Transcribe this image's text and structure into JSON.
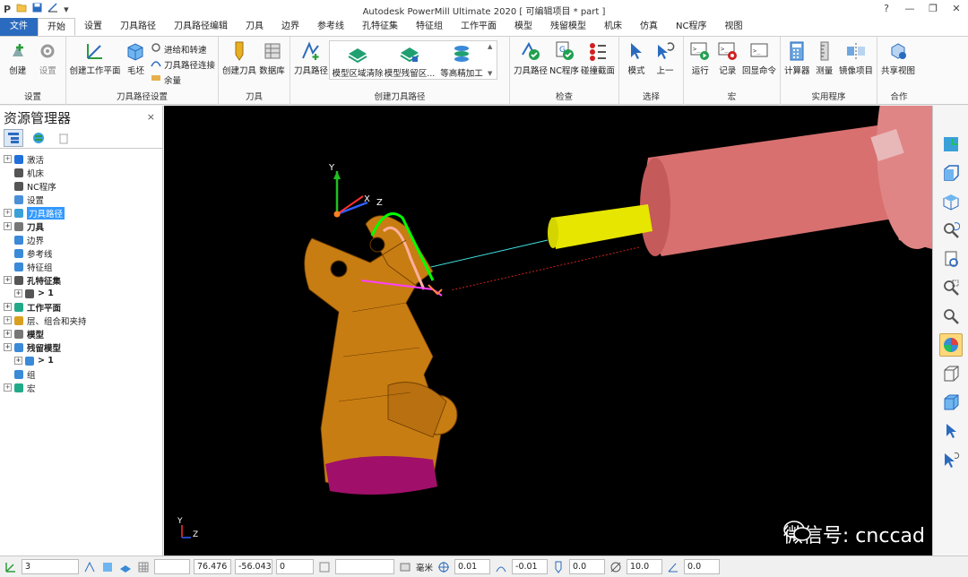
{
  "app": {
    "title": "Autodesk PowerMill Ultimate 2020    [ 可编辑项目 * part ]",
    "logo": "P",
    "quick_access": [
      "open-icon",
      "save-icon",
      "measure-icon"
    ]
  },
  "window_buttons": [
    "?",
    "—",
    "❐",
    "✕"
  ],
  "tabs": [
    {
      "label": "文件",
      "file": true
    },
    {
      "label": "开始",
      "active": true
    },
    {
      "label": "设置"
    },
    {
      "label": "刀具路径"
    },
    {
      "label": "刀具路径编辑"
    },
    {
      "label": "刀具"
    },
    {
      "label": "边界"
    },
    {
      "label": "参考线"
    },
    {
      "label": "孔特征集"
    },
    {
      "label": "特征组"
    },
    {
      "label": "工作平面"
    },
    {
      "label": "模型"
    },
    {
      "label": "残留模型"
    },
    {
      "label": "机床"
    },
    {
      "label": "仿真"
    },
    {
      "label": "NC程序"
    },
    {
      "label": "视图"
    }
  ],
  "ribbon": {
    "setup": {
      "label": "设置",
      "create": "创建",
      "settings": "设置"
    },
    "toolpath_setup": {
      "label": "刀具路径设置",
      "create_workplane": "创建工作平面",
      "block": "毛坯",
      "leads": "进给和转速",
      "connections": "刀具路径连接",
      "thickness": "余量"
    },
    "tool": {
      "label": "刀具",
      "create_tool": "创建刀具",
      "database": "数据库"
    },
    "create_toolpath": {
      "label": "创建刀具路径",
      "toolpath": "刀具路径",
      "items": [
        "模型区域清除",
        "模型残留区...",
        "等高精加工"
      ]
    },
    "verify": {
      "label": "检查",
      "toolpath": "刀具路径",
      "nc": "NC程序",
      "collision": "碰撞截面"
    },
    "select": {
      "label": "选择",
      "mode": "模式",
      "prev": "上一"
    },
    "macro": {
      "label": "宏",
      "run": "运行",
      "record": "记录",
      "echo": "回显命令"
    },
    "utilities": {
      "label": "实用程序",
      "calculator": "计算器",
      "measure": "测量",
      "mirror": "镜像项目"
    },
    "collab": {
      "label": "合作",
      "share": "共享视图"
    }
  },
  "explorer": {
    "title": "资源管理器",
    "close": "×",
    "nodes": [
      {
        "label": "激活",
        "exp": true,
        "icon": "activate-icon",
        "color": "#1e6fd9"
      },
      {
        "label": "机床",
        "exp": false,
        "icon": "machine-icon",
        "color": "#555"
      },
      {
        "label": "NC程序",
        "exp": false,
        "icon": "nc-program-icon",
        "color": "#555"
      },
      {
        "label": "设置",
        "exp": false,
        "icon": "setup-icon",
        "color": "#4a90d9"
      },
      {
        "label": "刀具路径",
        "exp": true,
        "icon": "toolpath-icon",
        "color": "#3aa0d8",
        "selected": true
      },
      {
        "label": "刀具",
        "exp": true,
        "icon": "tool-icon",
        "color": "#777",
        "bold": true
      },
      {
        "label": "边界",
        "exp": false,
        "icon": "boundary-icon",
        "color": "#3a8ad8"
      },
      {
        "label": "参考线",
        "exp": false,
        "icon": "pattern-icon",
        "color": "#3a8ad8"
      },
      {
        "label": "特征组",
        "exp": false,
        "icon": "feature-group-icon",
        "color": "#3a8ad8"
      },
      {
        "label": "孔特征集",
        "exp": true,
        "icon": "hole-feature-icon",
        "color": "#555",
        "bold": true
      },
      {
        "label": "> 1",
        "exp": true,
        "icon": "hole-set-icon",
        "color": "#555",
        "indent": true,
        "bold": true
      },
      {
        "label": "工作平面",
        "exp": true,
        "icon": "workplane-icon",
        "color": "#2a8",
        "bold": true
      },
      {
        "label": "层、组合和夹持",
        "exp": true,
        "icon": "layer-icon",
        "color": "#d9a020"
      },
      {
        "label": "模型",
        "exp": true,
        "icon": "model-icon",
        "color": "#777",
        "bold": true
      },
      {
        "label": "残留模型",
        "exp": true,
        "icon": "stock-model-icon",
        "color": "#3a8ad8",
        "bold": true
      },
      {
        "label": "> 1",
        "exp": true,
        "icon": "stock-model-item-icon",
        "color": "#3a8ad8",
        "indent": true,
        "bold": true
      },
      {
        "label": "组",
        "exp": false,
        "icon": "group-icon",
        "color": "#3a8ad8"
      },
      {
        "label": "宏",
        "exp": true,
        "icon": "macro-icon",
        "color": "#2a8"
      }
    ]
  },
  "viewport": {
    "axis_labels": {
      "y": "Y",
      "x": "X",
      "z": "Z"
    },
    "corner_axis": {
      "y": "Y",
      "z": "Z"
    },
    "watermark": "微信号: cnccad"
  },
  "statusbar": {
    "workplane": "3",
    "x": "76.476",
    "y": "-56.043",
    "z": "0",
    "units": "毫米",
    "tolerance": "0.01",
    "thickness": "-0.01",
    "tool_value": "0.0",
    "diameter": "10.0",
    "angle": "0.0"
  }
}
